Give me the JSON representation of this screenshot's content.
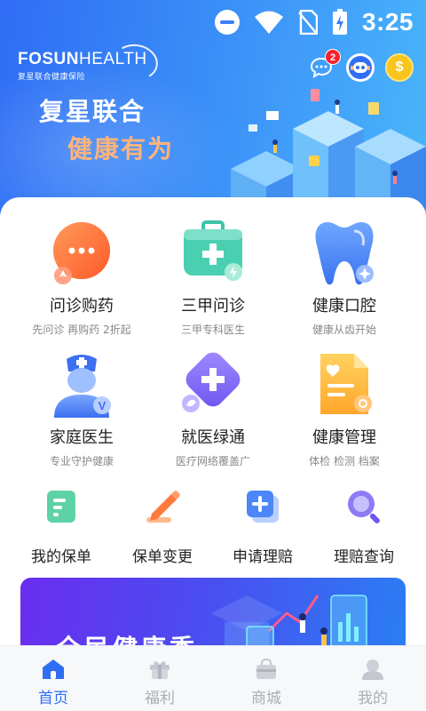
{
  "status_bar": {
    "time": "3:25"
  },
  "brand": {
    "name_bold": "FOSUN",
    "name_light": "HEALTH",
    "subtitle": "复星联合健康保险"
  },
  "header": {
    "message_badge": "2",
    "coin_symbol": "$"
  },
  "hero": {
    "slogan_line1": "复星联合",
    "slogan_line2": "健康有为"
  },
  "services": [
    {
      "title": "问诊购药",
      "subtitle": "先问诊 再购药 2折起"
    },
    {
      "title": "三甲问诊",
      "subtitle": "三甲专科医生"
    },
    {
      "title": "健康口腔",
      "subtitle": "健康从齿开始"
    },
    {
      "title": "家庭医生",
      "subtitle": "专业守护健康"
    },
    {
      "title": "就医绿通",
      "subtitle": "医疗网络覆盖广"
    },
    {
      "title": "健康管理",
      "subtitle": "体检 检测 档案"
    }
  ],
  "quick_actions": [
    {
      "label": "我的保单"
    },
    {
      "label": "保单变更"
    },
    {
      "label": "申请理赔"
    },
    {
      "label": "理赔查询"
    }
  ],
  "banner": {
    "title": "全民健康季"
  },
  "tabbar": {
    "items": [
      {
        "label": "首页",
        "active": true
      },
      {
        "label": "福利",
        "active": false
      },
      {
        "label": "商城",
        "active": false
      },
      {
        "label": "我的",
        "active": false
      }
    ]
  },
  "colors": {
    "primary": "#2f6df5",
    "accent_orange": "#ffb47a",
    "badge_red": "#f5222d"
  }
}
